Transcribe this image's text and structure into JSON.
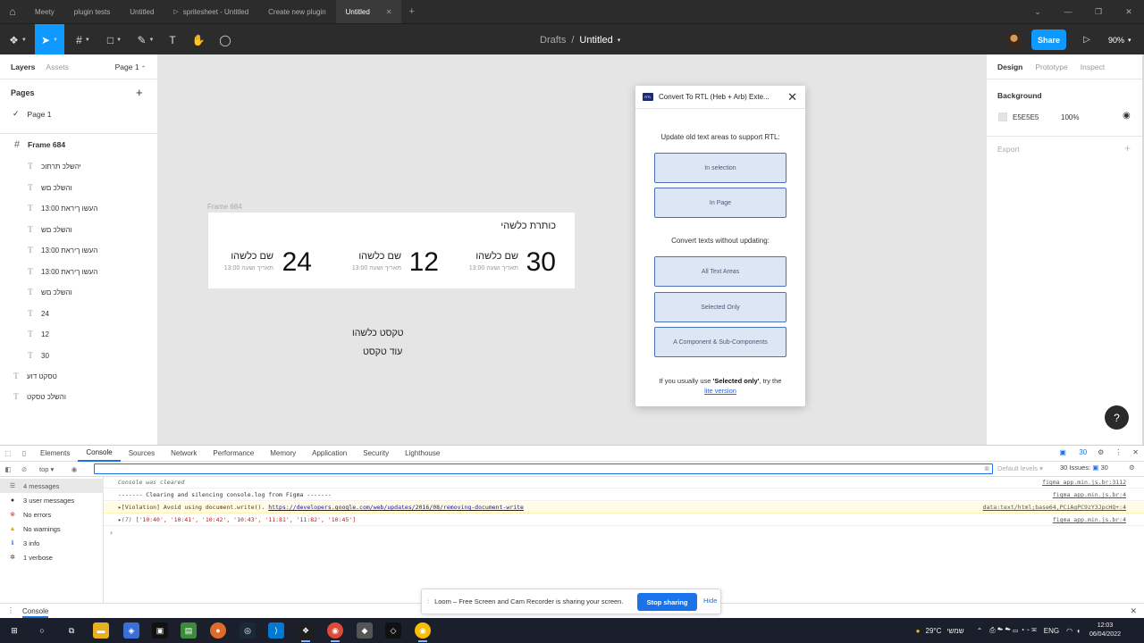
{
  "tabs": [
    {
      "label": "Meety",
      "icon": "",
      "active": false
    },
    {
      "label": "plugin tests",
      "icon": "",
      "active": false
    },
    {
      "label": "Untitled",
      "icon": "",
      "active": false
    },
    {
      "label": "spritesheet - Untitled",
      "icon": "play-icon",
      "active": false
    },
    {
      "label": "Create new plugin",
      "icon": "",
      "active": false
    },
    {
      "label": "Untitled",
      "icon": "",
      "active": true
    }
  ],
  "toolbar": {
    "breadcrumb_drafts": "Drafts",
    "breadcrumb_sep": "/",
    "doc_title": "Untitled",
    "share_label": "Share",
    "zoom_level": "90%"
  },
  "left_panel": {
    "tab_layers": "Layers",
    "tab_assets": "Assets",
    "page_selector": "Page 1",
    "pages_heading": "Pages",
    "page_item": "Page 1",
    "layers": [
      {
        "label": "Frame 684",
        "kind": "frame"
      },
      {
        "label": "יהשלכ תרתוכ",
        "kind": "text"
      },
      {
        "label": "והשלכ םש",
        "kind": "text"
      },
      {
        "label": "13:00 העשו ךיראת",
        "kind": "text"
      },
      {
        "label": "והשלכ םש",
        "kind": "text"
      },
      {
        "label": "13:00 העשו ךיראת",
        "kind": "text"
      },
      {
        "label": "13:00 העשו ךיראת",
        "kind": "text"
      },
      {
        "label": "והשלכ םש",
        "kind": "text"
      },
      {
        "label": "24",
        "kind": "text"
      },
      {
        "label": "12",
        "kind": "text"
      },
      {
        "label": "30",
        "kind": "text"
      },
      {
        "label": "טסקט דוע",
        "kind": "text-root"
      },
      {
        "label": "והשלכ טסקט",
        "kind": "text-root"
      }
    ]
  },
  "canvas": {
    "frame_label": "Frame 684",
    "frame_title": "כותרת כלשהי",
    "stats": [
      {
        "number": "30",
        "name": "שם כלשהו",
        "sub": "תאריך ושעה 13:00"
      },
      {
        "number": "12",
        "name": "שם כלשהו",
        "sub": "תאריך ושעה 13:00"
      },
      {
        "number": "24",
        "name": "שם כלשהו",
        "sub": "תאריך ושעה 13:00"
      }
    ],
    "free_text_1": "טקסט כלשהו",
    "free_text_2": "עוד טקסט"
  },
  "plugin": {
    "title": "Convert To RTL (Heb + Arb) Exte...",
    "close_glyph": "✕",
    "update_heading": "Update old text areas to support RTL:",
    "btn_in_selection": "In selection",
    "btn_in_page": "In Page",
    "convert_heading": "Convert texts without updating:",
    "btn_all_text": "All Text Areas",
    "btn_selected_only": "Selected Only",
    "btn_component": "A Component & Sub-Components",
    "foot_prefix": "If you usually use ",
    "foot_bold": "'Selected only'",
    "foot_suffix": ", try the",
    "foot_link": "lite version"
  },
  "right_panel": {
    "tab_design": "Design",
    "tab_prototype": "Prototype",
    "tab_inspect": "Inspect",
    "background_heading": "Background",
    "bg_hex": "E5E5E5",
    "bg_opacity": "100%",
    "export_heading": "Export",
    "help_label": "?"
  },
  "devtools": {
    "tabs": [
      "Elements",
      "Console",
      "Sources",
      "Network",
      "Performance",
      "Memory",
      "Application",
      "Security",
      "Lighthouse"
    ],
    "active_tab": "Console",
    "issues_badge": "30",
    "context": "top",
    "default_levels": "Default levels ▾",
    "issues_count": "30 Issues:",
    "issues_count_badge": "30",
    "sidebar": [
      {
        "label": "4 messages",
        "icon": "list-icon"
      },
      {
        "label": "3 user messages",
        "icon": "user-icon"
      },
      {
        "label": "No errors",
        "icon": "error-icon"
      },
      {
        "label": "No warnings",
        "icon": "warning-icon"
      },
      {
        "label": "3 info",
        "icon": "info-icon"
      },
      {
        "label": "1 verbose",
        "icon": "verbose-icon"
      }
    ],
    "console_lines": [
      {
        "text": "Console was cleared",
        "source": "figma_app.min.js.br:3112",
        "type": "cleared"
      },
      {
        "text": "------- Clearing and silencing console.log from Figma -------",
        "source": "figma_app.min.js.br:4",
        "type": "log"
      },
      {
        "text_prefix": "[Violation] Avoid using document.write(). ",
        "link": "https://developers.google.com/web/updates/2016/08/removing-document-write",
        "source": "data:text/html;base64,PCiAgPC9zY3JpcHQ+:4",
        "type": "warn"
      },
      {
        "text_prefix": "(7) ",
        "array": "['10:40', '10:41', '10:42', '10:43', '11:81', '11:82', '10:45']",
        "source": "figma_app.min.js.br:4",
        "type": "array"
      }
    ],
    "drawer_tab": "Console"
  },
  "loom": {
    "message": "Loom – Free Screen and Cam Recorder is sharing your screen.",
    "stop_label": "Stop sharing",
    "hide_label": "Hide"
  },
  "taskbar": {
    "weather": "29°C",
    "weather_text": "שמשי",
    "lang": "ENG",
    "time": "12:03",
    "date": "06/04/2022"
  },
  "colors": {
    "figma_blue": "#0d99ff",
    "canvas_bg": "#e5e5e5",
    "plugin_btn_bg": "#dce6f5",
    "plugin_btn_border": "#4a72b8",
    "devtools_blue": "#1a73e8"
  }
}
